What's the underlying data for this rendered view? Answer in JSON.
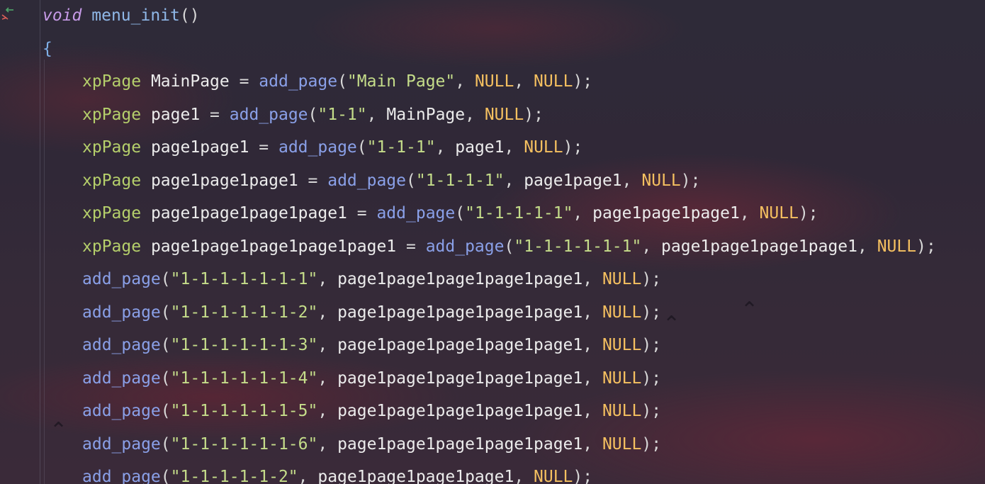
{
  "editor": {
    "colors": {
      "keyword": "#c79be8",
      "type": "#b5cf6b",
      "function": "#8aa0e8",
      "string": "#c5dd8a",
      "null": "#f5c060",
      "text": "#ececec"
    },
    "gutter_icon": "recursive-call-icon",
    "lines": [
      {
        "kind": "decl",
        "keyword": "void",
        "name": "menu_init",
        "rest": "()"
      },
      {
        "kind": "brace",
        "text": "{"
      },
      {
        "kind": "assign",
        "type": "xpPage",
        "var": "MainPage",
        "fn": "add_page",
        "str": "\"Main Page\"",
        "parent": "NULL",
        "last": "NULL"
      },
      {
        "kind": "assign",
        "type": "xpPage",
        "var": "page1",
        "fn": "add_page",
        "str": "\"1-1\"",
        "parent": "MainPage",
        "last": "NULL"
      },
      {
        "kind": "assign",
        "type": "xpPage",
        "var": "page1page1",
        "fn": "add_page",
        "str": "\"1-1-1\"",
        "parent": "page1",
        "last": "NULL"
      },
      {
        "kind": "assign",
        "type": "xpPage",
        "var": "page1page1page1",
        "fn": "add_page",
        "str": "\"1-1-1-1\"",
        "parent": "page1page1",
        "last": "NULL"
      },
      {
        "kind": "assign",
        "type": "xpPage",
        "var": "page1page1page1page1",
        "fn": "add_page",
        "str": "\"1-1-1-1-1\"",
        "parent": "page1page1page1",
        "last": "NULL"
      },
      {
        "kind": "assign",
        "type": "xpPage",
        "var": "page1page1page1page1page1",
        "fn": "add_page",
        "str": "\"1-1-1-1-1-1\"",
        "parent": "page1page1page1page1",
        "last": "NULL"
      },
      {
        "kind": "call",
        "fn": "add_page",
        "str": "\"1-1-1-1-1-1-1\"",
        "parent": "page1page1page1page1page1",
        "last": "NULL"
      },
      {
        "kind": "call",
        "fn": "add_page",
        "str": "\"1-1-1-1-1-1-2\"",
        "parent": "page1page1page1page1page1",
        "last": "NULL"
      },
      {
        "kind": "call",
        "fn": "add_page",
        "str": "\"1-1-1-1-1-1-3\"",
        "parent": "page1page1page1page1page1",
        "last": "NULL"
      },
      {
        "kind": "call",
        "fn": "add_page",
        "str": "\"1-1-1-1-1-1-4\"",
        "parent": "page1page1page1page1page1",
        "last": "NULL"
      },
      {
        "kind": "call",
        "fn": "add_page",
        "str": "\"1-1-1-1-1-1-5\"",
        "parent": "page1page1page1page1page1",
        "last": "NULL"
      },
      {
        "kind": "call",
        "fn": "add_page",
        "str": "\"1-1-1-1-1-1-6\"",
        "parent": "page1page1page1page1page1",
        "last": "NULL"
      },
      {
        "kind": "call",
        "fn": "add_page",
        "str": "\"1-1-1-1-1-2\"",
        "parent": "page1page1page1page1",
        "last": "NULL"
      }
    ]
  }
}
